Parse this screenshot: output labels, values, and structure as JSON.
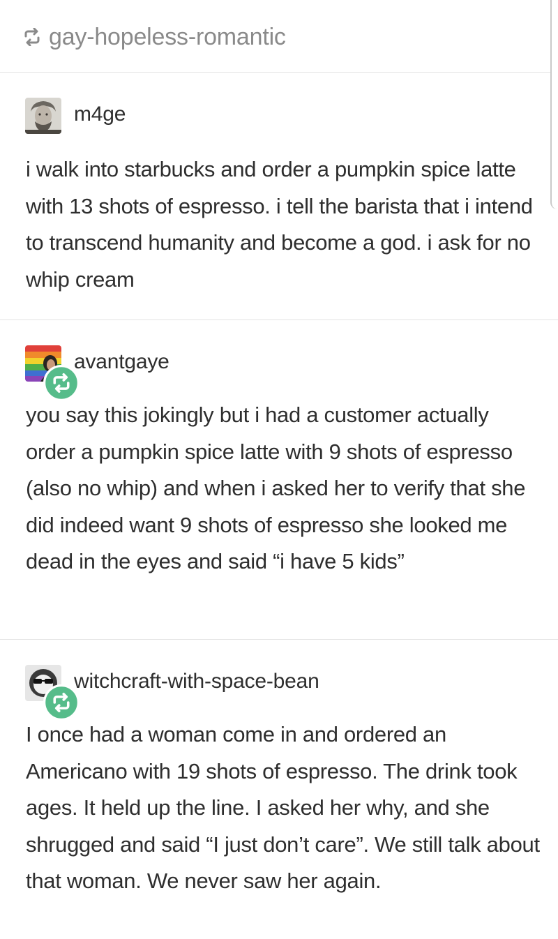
{
  "reblog_header": {
    "icon": "reblog-icon",
    "name": "gay-hopeless-romantic"
  },
  "posts": [
    {
      "username": "m4ge",
      "avatar": "portrait-avatar",
      "reblog_badge": false,
      "text": "i walk into starbucks and order a pumpkin spice latte with 13 shots of espresso. i tell the barista that i intend to transcend humanity and become a god. i ask for no whip cream"
    },
    {
      "username": "avantgaye",
      "avatar": "rainbow-avatar",
      "reblog_badge": true,
      "text": "you say this jokingly but i had a customer actually order a pumpkin spice latte with 9 shots of espresso (also no whip) and when i asked her to verify that she did indeed want 9 shots of espresso she looked me dead in the eyes and said “i have 5 kids”"
    },
    {
      "username": "witchcraft-with-space-bean",
      "avatar": "sunglasses-avatar",
      "reblog_badge": true,
      "text": "I once had a woman come in and ordered an Americano with 19 shots of espresso. The drink took ages. It held up the line. I asked her why, and she shrugged and said “I just don’t care”. We still talk about that woman. We never saw her again."
    }
  ],
  "colors": {
    "text": "#2e2e2e",
    "muted": "#8a8a8a",
    "divider": "#e3e3e3",
    "badge": "#56bc8a"
  }
}
